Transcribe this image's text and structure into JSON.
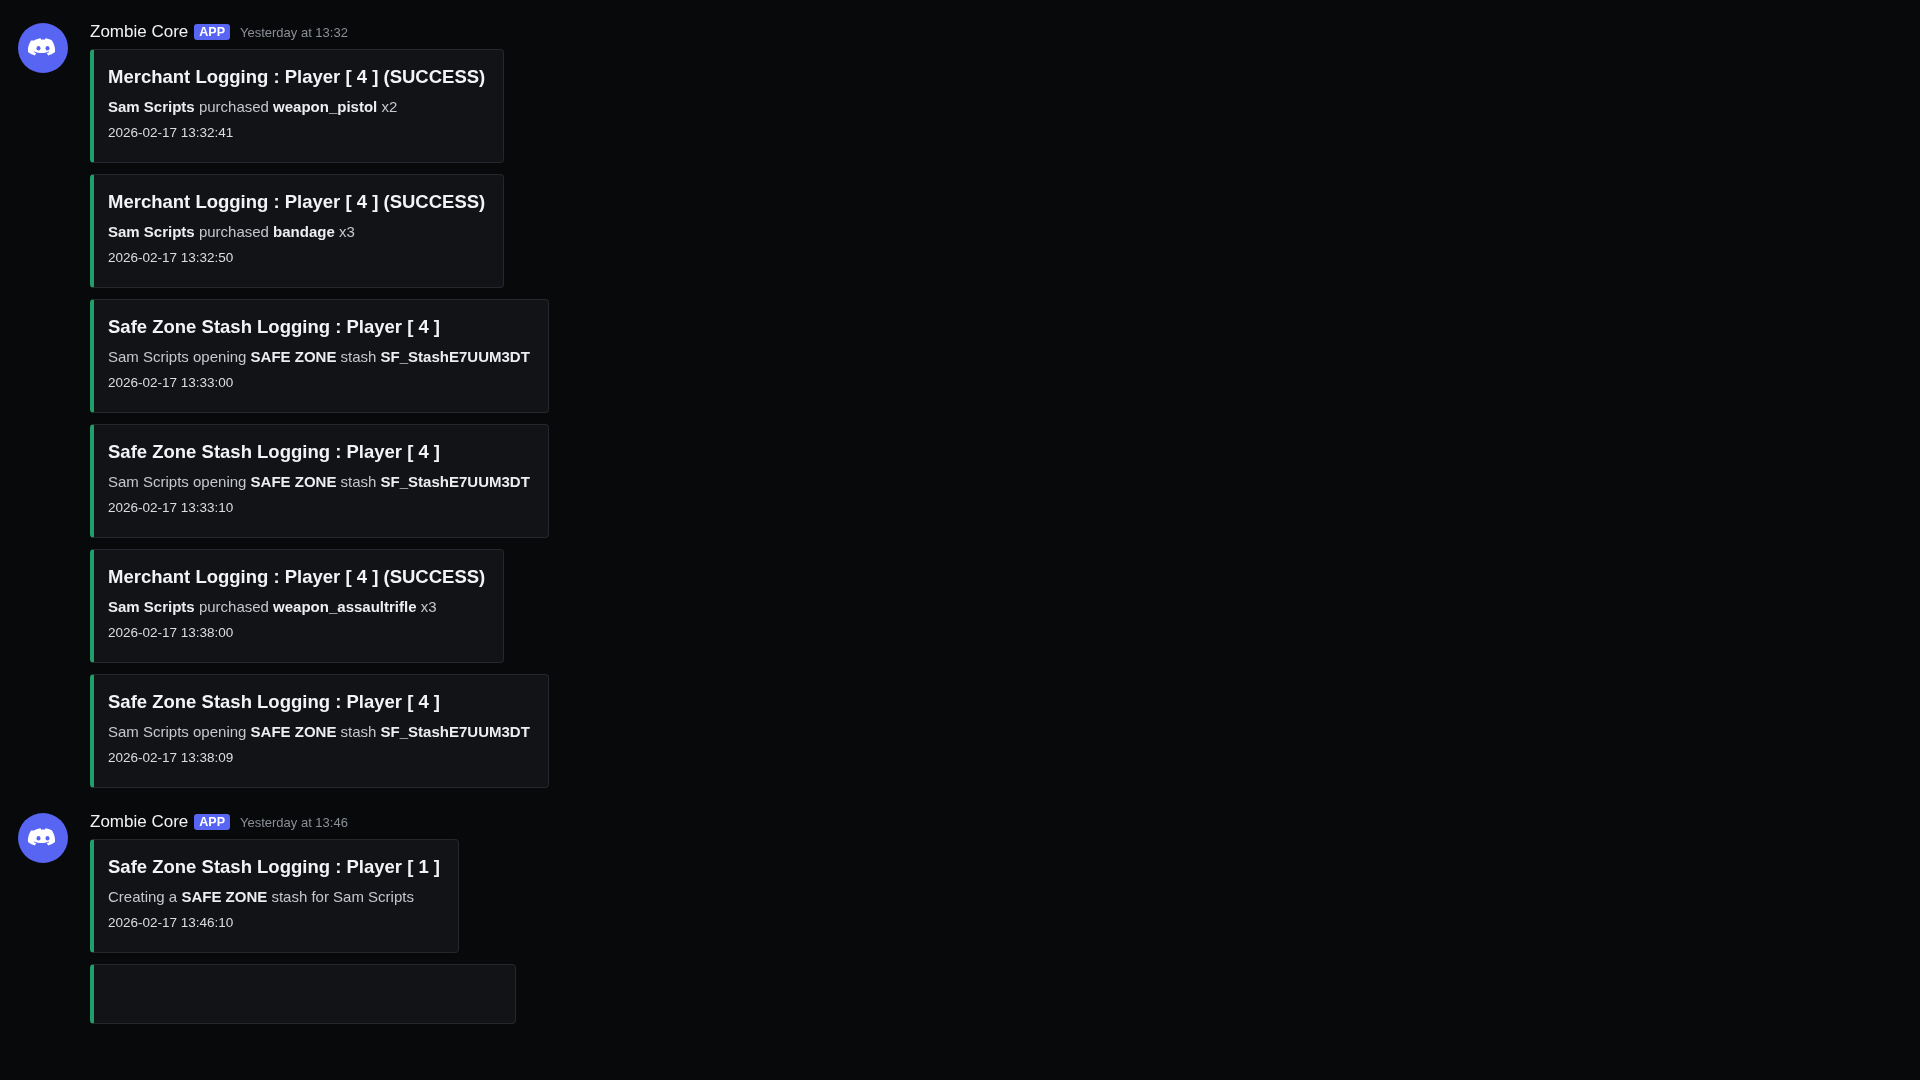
{
  "messages": [
    {
      "author": "Zombie Core",
      "badge": "APP",
      "time": "Yesterday at 13:32",
      "embeds": [
        {
          "kind": "log",
          "title": "Merchant Logging : Player [ 4 ]  (SUCCESS)",
          "body": "**Sam Scripts** purchased **weapon_pistol** x2",
          "timestamp": "2026-02-17 13:32:41"
        },
        {
          "kind": "log",
          "title": "Merchant Logging : Player [ 4 ]  (SUCCESS)",
          "body": "**Sam Scripts** purchased **bandage** x3",
          "timestamp": "2026-02-17 13:32:50"
        },
        {
          "kind": "log",
          "title": "Safe Zone Stash Logging : Player [ 4 ]",
          "body": "Sam Scripts opening **SAFE ZONE** stash **SF_StashE7UUM3DT**",
          "timestamp": "2026-02-17 13:33:00"
        },
        {
          "kind": "log",
          "title": "Safe Zone Stash Logging : Player [ 4 ]",
          "body": "Sam Scripts opening **SAFE ZONE** stash **SF_StashE7UUM3DT**",
          "timestamp": "2026-02-17 13:33:10"
        },
        {
          "kind": "log",
          "title": "Merchant Logging : Player [ 4 ]  (SUCCESS)",
          "body": "**Sam Scripts** purchased **weapon_assaultrifle** x3",
          "timestamp": "2026-02-17 13:38:00"
        },
        {
          "kind": "log",
          "title": "Safe Zone Stash Logging : Player [ 4 ]",
          "body": "Sam Scripts opening **SAFE ZONE** stash **SF_StashE7UUM3DT**",
          "timestamp": "2026-02-17 13:38:09"
        }
      ]
    },
    {
      "author": "Zombie Core",
      "badge": "APP",
      "time": "Yesterday at 13:46",
      "embeds": [
        {
          "kind": "log",
          "title": "Safe Zone Stash Logging : Player [ 1 ]",
          "body": "Creating a **SAFE ZONE** stash for Sam Scripts",
          "timestamp": "2026-02-17 13:46:10"
        },
        {
          "kind": "cut"
        }
      ]
    }
  ]
}
